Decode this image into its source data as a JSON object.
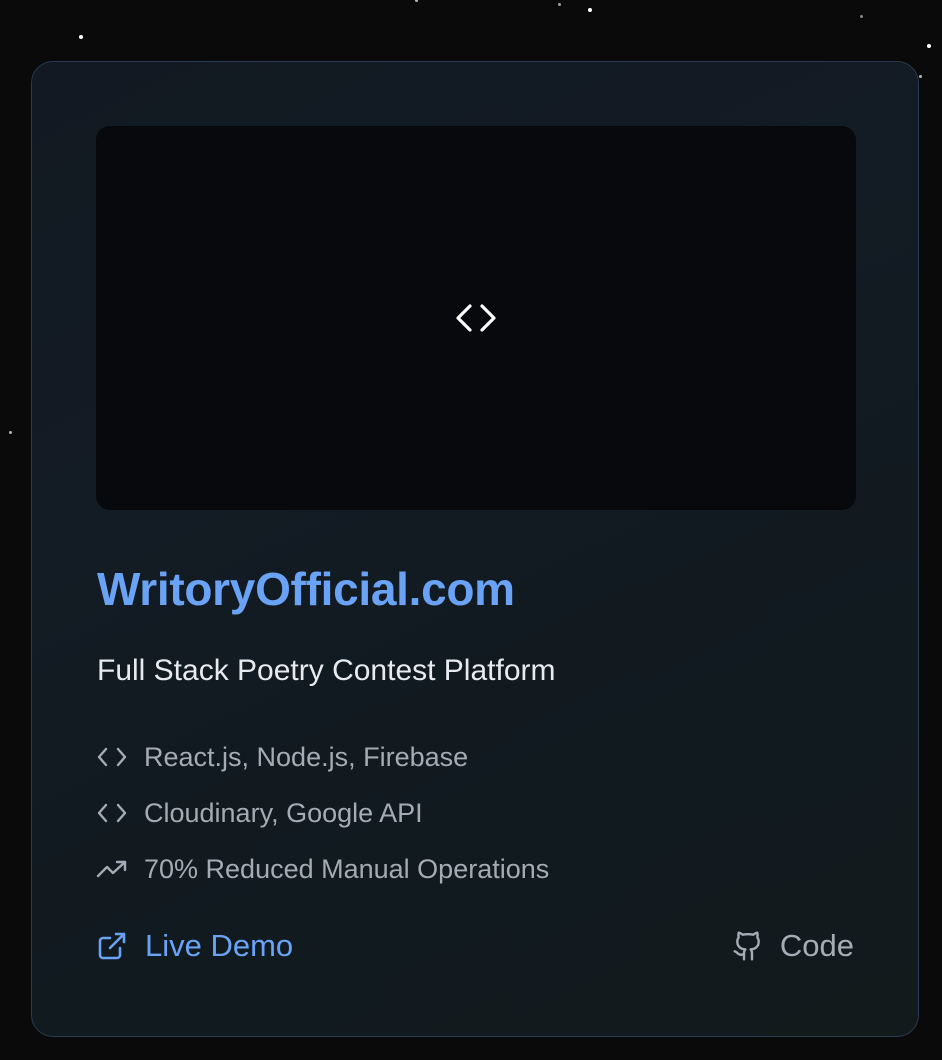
{
  "project": {
    "title": "WritoryOfficial.com",
    "subtitle": "Full Stack Poetry Contest Platform",
    "preview_icon": "code-brackets-icon",
    "features": [
      {
        "icon": "code-icon",
        "label": "React.js, Node.js, Firebase"
      },
      {
        "icon": "code-icon",
        "label": "Cloudinary, Google API"
      },
      {
        "icon": "trending-up-icon",
        "label": "70% Reduced Manual Operations"
      }
    ],
    "links": {
      "demo": {
        "icon": "external-link-icon",
        "label": "Live Demo"
      },
      "code": {
        "icon": "github-icon",
        "label": "Code"
      }
    }
  },
  "colors": {
    "accent": "#6aa3f5",
    "muted_text": "#a5abb4",
    "subtitle_text": "#e7eaee",
    "card_border": "#2a3a52",
    "background": "#0a0a0b"
  }
}
